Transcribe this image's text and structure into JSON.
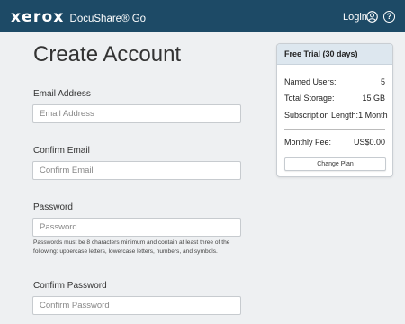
{
  "header": {
    "logo": "xerox",
    "product": "DocuShare® Go",
    "login_label": "Login",
    "help_glyph": "?"
  },
  "page": {
    "title": "Create Account"
  },
  "form": {
    "email_label": "Email Address",
    "email_placeholder": "Email Address",
    "confirm_email_label": "Confirm Email",
    "confirm_email_placeholder": "Confirm Email",
    "password_label": "Password",
    "password_placeholder": "Password",
    "password_hint": "Passwords must be 8 characters minimum and contain at least three of the following: uppercase letters, lowercase letters, numbers, and symbols.",
    "confirm_password_label": "Confirm Password",
    "confirm_password_placeholder": "Confirm Password"
  },
  "trial": {
    "title": "Free Trial (30 days)",
    "named_users_label": "Named Users:",
    "named_users_value": "5",
    "storage_label": "Total Storage:",
    "storage_value": "15 GB",
    "subscription_label": "Subscription Length:",
    "subscription_value": "1 Month",
    "fee_label": "Monthly Fee:",
    "fee_value": "US$0.00",
    "change_plan_label": "Change Plan"
  },
  "icons": {
    "user": "user-circle-icon",
    "help": "help-icon"
  },
  "colors": {
    "header_bg": "#1d4a66",
    "page_bg": "#eef0f2",
    "card_header_bg": "#dde7ef"
  }
}
